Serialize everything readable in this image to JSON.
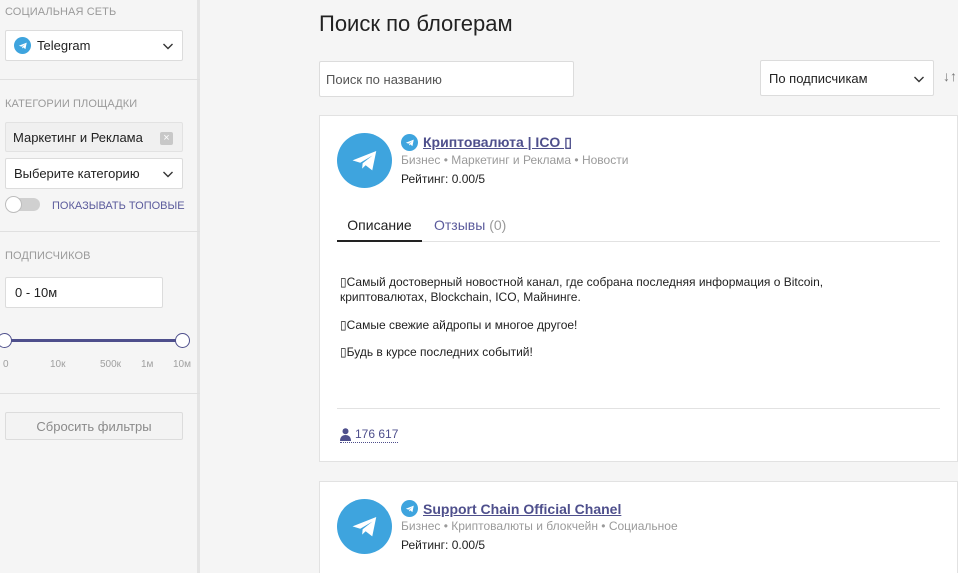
{
  "sidebar": {
    "social_label": "СОЦИАЛЬНАЯ СЕТЬ",
    "social_value": "Telegram",
    "categories_label": "КАТЕГОРИИ ПЛОЩАДКИ",
    "selected_category": "Маркетинг и Реклама",
    "chip_remove": "×",
    "category_placeholder": "Выберите категорию",
    "show_top_label": "ПОКАЗЫВАТЬ ТОПОВЫЕ",
    "show_top_enabled": false,
    "subscribers_label": "ПОДПИСЧИКОВ",
    "subscribers_value": "0 - 10м",
    "slider_ticks": [
      "0",
      "10к",
      "500к",
      "1м",
      "10м"
    ],
    "reset_label": "Сбросить фильтры"
  },
  "main": {
    "title": "Поиск по блогерам",
    "search_placeholder": "Поиск по названию",
    "sort_value": "По подписчикам",
    "sort_direction_icon": "↓↑"
  },
  "cards": [
    {
      "title": "Криптовалюта | ICO ▯",
      "meta": "Бизнес • Маркетинг и Реклама • Новости",
      "rating": "Рейтинг: 0.00/5",
      "tab_description": "Описание",
      "tab_reviews": "Отзывы",
      "tab_reviews_count": "(0)",
      "description": [
        "▯Самый достоверный новостной канал, где собрана последняя информация о Bitcoin, криптовалютах, Blockchain, ICO, Майнинге.",
        "▯Самые свежие айдропы и многое другое!",
        "▯Будь в курсе последних событий!"
      ],
      "subscribers": "176 617"
    },
    {
      "title": "Support Chain Official Chanel",
      "meta": "Бизнес • Криптовалюты и блокчейн • Социальное",
      "rating": "Рейтинг: 0.00/5"
    }
  ],
  "colors": {
    "accent": "#4e4f8c",
    "telegram": "#3ea4de",
    "muted": "#9a9a9a"
  }
}
